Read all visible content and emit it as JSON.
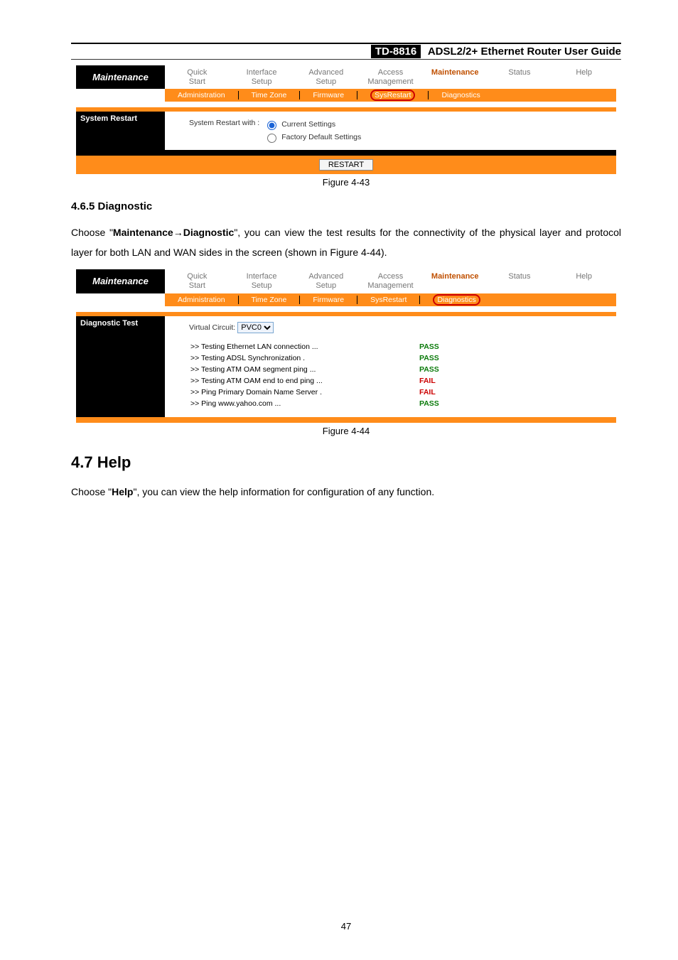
{
  "docheader": {
    "model": "TD-8816",
    "product": "ADSL2/2+ Ethernet Router User Guide"
  },
  "fig1": {
    "sideTitle": "Maintenance",
    "tabs": [
      "Quick\nStart",
      "Interface\nSetup",
      "Advanced\nSetup",
      "Access\nManagement",
      "Maintenance",
      "Status",
      "Help"
    ],
    "activeTabIndex": 4,
    "subnav": [
      "Administration",
      "Time Zone",
      "Firmware",
      "SysRestart",
      "Diagnostics"
    ],
    "circledIndex": 3,
    "panelLabel": "System Restart",
    "restartLabel": "System Restart with :",
    "radio1": "Current Settings",
    "radio2": "Factory Default Settings",
    "button": "RESTART",
    "caption": "Figure 4-43"
  },
  "sec465": {
    "heading": "4.6.5  Diagnostic",
    "para_a": "Choose \"",
    "para_b": "Maintenance",
    "para_c": "Diagnostic",
    "para_d": "\", you can view the test results for the connectivity of the physical layer and protocol layer for both LAN and WAN sides in the screen (shown in Figure 4-44)."
  },
  "fig2": {
    "sideTitle": "Maintenance",
    "tabs": [
      "Quick\nStart",
      "Interface\nSetup",
      "Advanced\nSetup",
      "Access\nManagement",
      "Maintenance",
      "Status",
      "Help"
    ],
    "activeTabIndex": 4,
    "subnav": [
      "Administration",
      "Time Zone",
      "Firmware",
      "SysRestart",
      "Diagnostics"
    ],
    "circledIndex": 4,
    "panelLabel": "Diagnostic Test",
    "vcLabel": "Virtual Circuit:",
    "vcValue": "PVC0",
    "rows": [
      {
        "t": ">> Testing Ethernet LAN connection ...",
        "r": "PASS"
      },
      {
        "t": ">> Testing ADSL Synchronization .",
        "r": "PASS"
      },
      {
        "t": ">> Testing ATM OAM segment ping ...",
        "r": "PASS"
      },
      {
        "t": ">> Testing ATM OAM end to end ping ...",
        "r": "FAIL"
      },
      {
        "t": ">> Ping Primary Domain Name Server .",
        "r": "FAIL"
      },
      {
        "t": ">> Ping www.yahoo.com ...",
        "r": "PASS"
      }
    ],
    "caption": "Figure 4-44"
  },
  "sec47": {
    "heading": "4.7   Help",
    "para_a": "Choose \"",
    "para_b": "Help",
    "para_c": "\", you can view the help information for configuration of any function."
  },
  "pageNumber": "47"
}
